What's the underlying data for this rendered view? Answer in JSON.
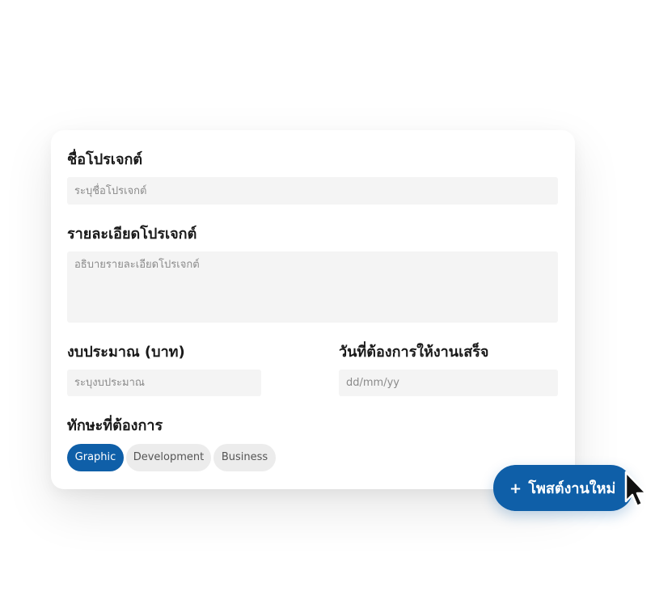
{
  "form": {
    "project_name_label": "ชื่อโปรเจกต์",
    "project_name_placeholder": "ระบุชื่อโปรเจกต์",
    "project_detail_label": "รายละเอียดโปรเจกต์",
    "project_detail_placeholder": "อธิบายรายละเอียดโปรเจกต์",
    "budget_label": "งบประมาณ (บาท)",
    "budget_placeholder": "ระบุงบประมาณ",
    "deadline_label": "วันที่ต้องการให้งานเสร็จ",
    "deadline_placeholder": "dd/mm/yy",
    "skills_label": "ทักษะที่ต้องการ",
    "skills": [
      {
        "label": "Graphic",
        "selected": true
      },
      {
        "label": "Development",
        "selected": false
      },
      {
        "label": "Business",
        "selected": false
      }
    ]
  },
  "post_button": {
    "plus": "+",
    "label": "โพสต์งานใหม่"
  },
  "colors": {
    "primary": "#0f5fa8",
    "chip_inactive": "#ececec",
    "field_bg": "#f4f4f4"
  },
  "icons": {
    "cursor": "mouse-pointer-icon"
  }
}
